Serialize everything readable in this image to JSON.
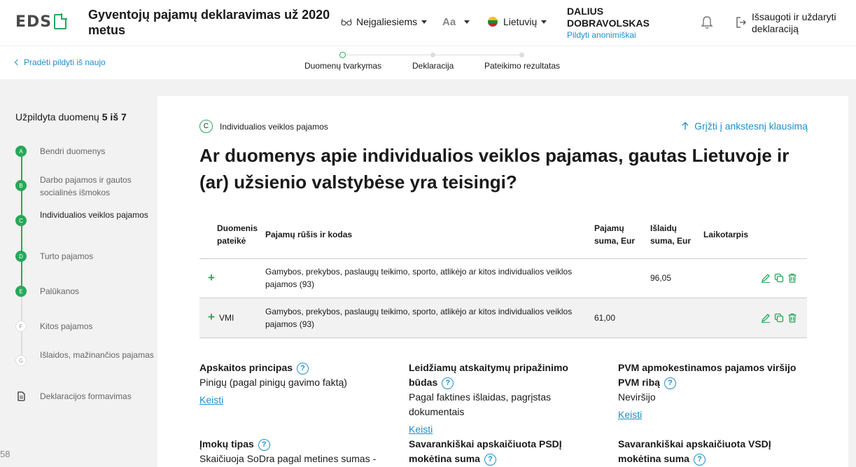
{
  "header": {
    "logo_text": "EDS",
    "title": "Gyventojų pajamų deklaravimas už 2020 metus",
    "accessibility_label": "Neįgaliesiems",
    "font_size_label": "Aa",
    "language_label": "Lietuvių",
    "user_name": "DALIUS DOBRAVOLSKAS",
    "anonymous_link": "Pildyti anonimiškai",
    "save_exit_label": "Išsaugoti ir uždaryti deklaraciją"
  },
  "subheader": {
    "restart_link": "Pradėti pildyti iš naujo",
    "steps": [
      "Duomenų tvarkymas",
      "Deklaracija",
      "Pateikimo rezultatas"
    ]
  },
  "sidebar": {
    "progress_prefix": "Užpildyta duomenų ",
    "progress_value": "5 iš 7",
    "items": [
      {
        "badge": "A",
        "label": "Bendri duomenys"
      },
      {
        "badge": "B",
        "label": "Darbo pajamos ir gautos socialinės išmokos"
      },
      {
        "badge": "C",
        "label": "Individualios veiklos pajamos"
      },
      {
        "badge": "D",
        "label": "Turto pajamos"
      },
      {
        "badge": "E",
        "label": "Palūkanos"
      },
      {
        "badge": "F",
        "label": "Kitos pajamos"
      },
      {
        "badge": "G",
        "label": "Išlaidos, mažinančios pajamas"
      },
      {
        "badge": "",
        "label": "Deklaracijos formavimas"
      }
    ],
    "page_number": "58"
  },
  "main": {
    "section_badge": "C",
    "section_label": "Individualios veiklos pajamos",
    "back_question_link": "Grįžti į ankstesnį klausimą",
    "question": "Ar duomenys apie individualios veiklos pajamas, gautas Lietuvoje ir (ar) užsienio valstybėse yra teisingi?",
    "table": {
      "headers": [
        "Duomenis pateikė",
        "Pajamų rūšis ir kodas",
        "Pajamų suma, Eur",
        "Išlaidų suma, Eur",
        "Laikotarpis"
      ],
      "rows": [
        {
          "provider": "",
          "type": "Gamybos, prekybos, paslaugų teikimo,  sporto, atlikėjo ar kitos individualios veiklos pajamos (93)",
          "income": "",
          "expenses": "96,05",
          "period": ""
        },
        {
          "provider": "VMI",
          "type": "Gamybos, prekybos, paslaugų teikimo,  sporto, atlikėjo ar kitos individualios veiklos pajamos (93)",
          "income": "61,00",
          "expenses": "",
          "period": ""
        }
      ]
    },
    "info": {
      "accounting": {
        "label": "Apskaitos principas",
        "value": "Pinigų (pagal pinigų gavimo faktą)",
        "edit": "Keisti"
      },
      "recognition": {
        "label": "Leidžiamų atskaitymų pripažinimo būdas",
        "value": "Pagal faktines išlaidas, pagrįstas dokumentais",
        "edit": "Keisti"
      },
      "vat": {
        "label": "PVM apmokestinamos pajamos viršijo PVM ribą",
        "value": "Neviršijo",
        "edit": "Keisti"
      },
      "payment_type": {
        "label": "Įmokų tipas",
        "value": "Skaičiuoja SoDra pagal metines sumas -"
      },
      "psd": {
        "label": "Savarankiškai apskaičiuota PSDĮ mokėtina suma"
      },
      "vsd": {
        "label": "Savarankiškai apskaičiuota VSDĮ mokėtina suma"
      }
    }
  },
  "colors": {
    "accent_green": "#27a85a",
    "link_blue": "#1e8fc9"
  }
}
